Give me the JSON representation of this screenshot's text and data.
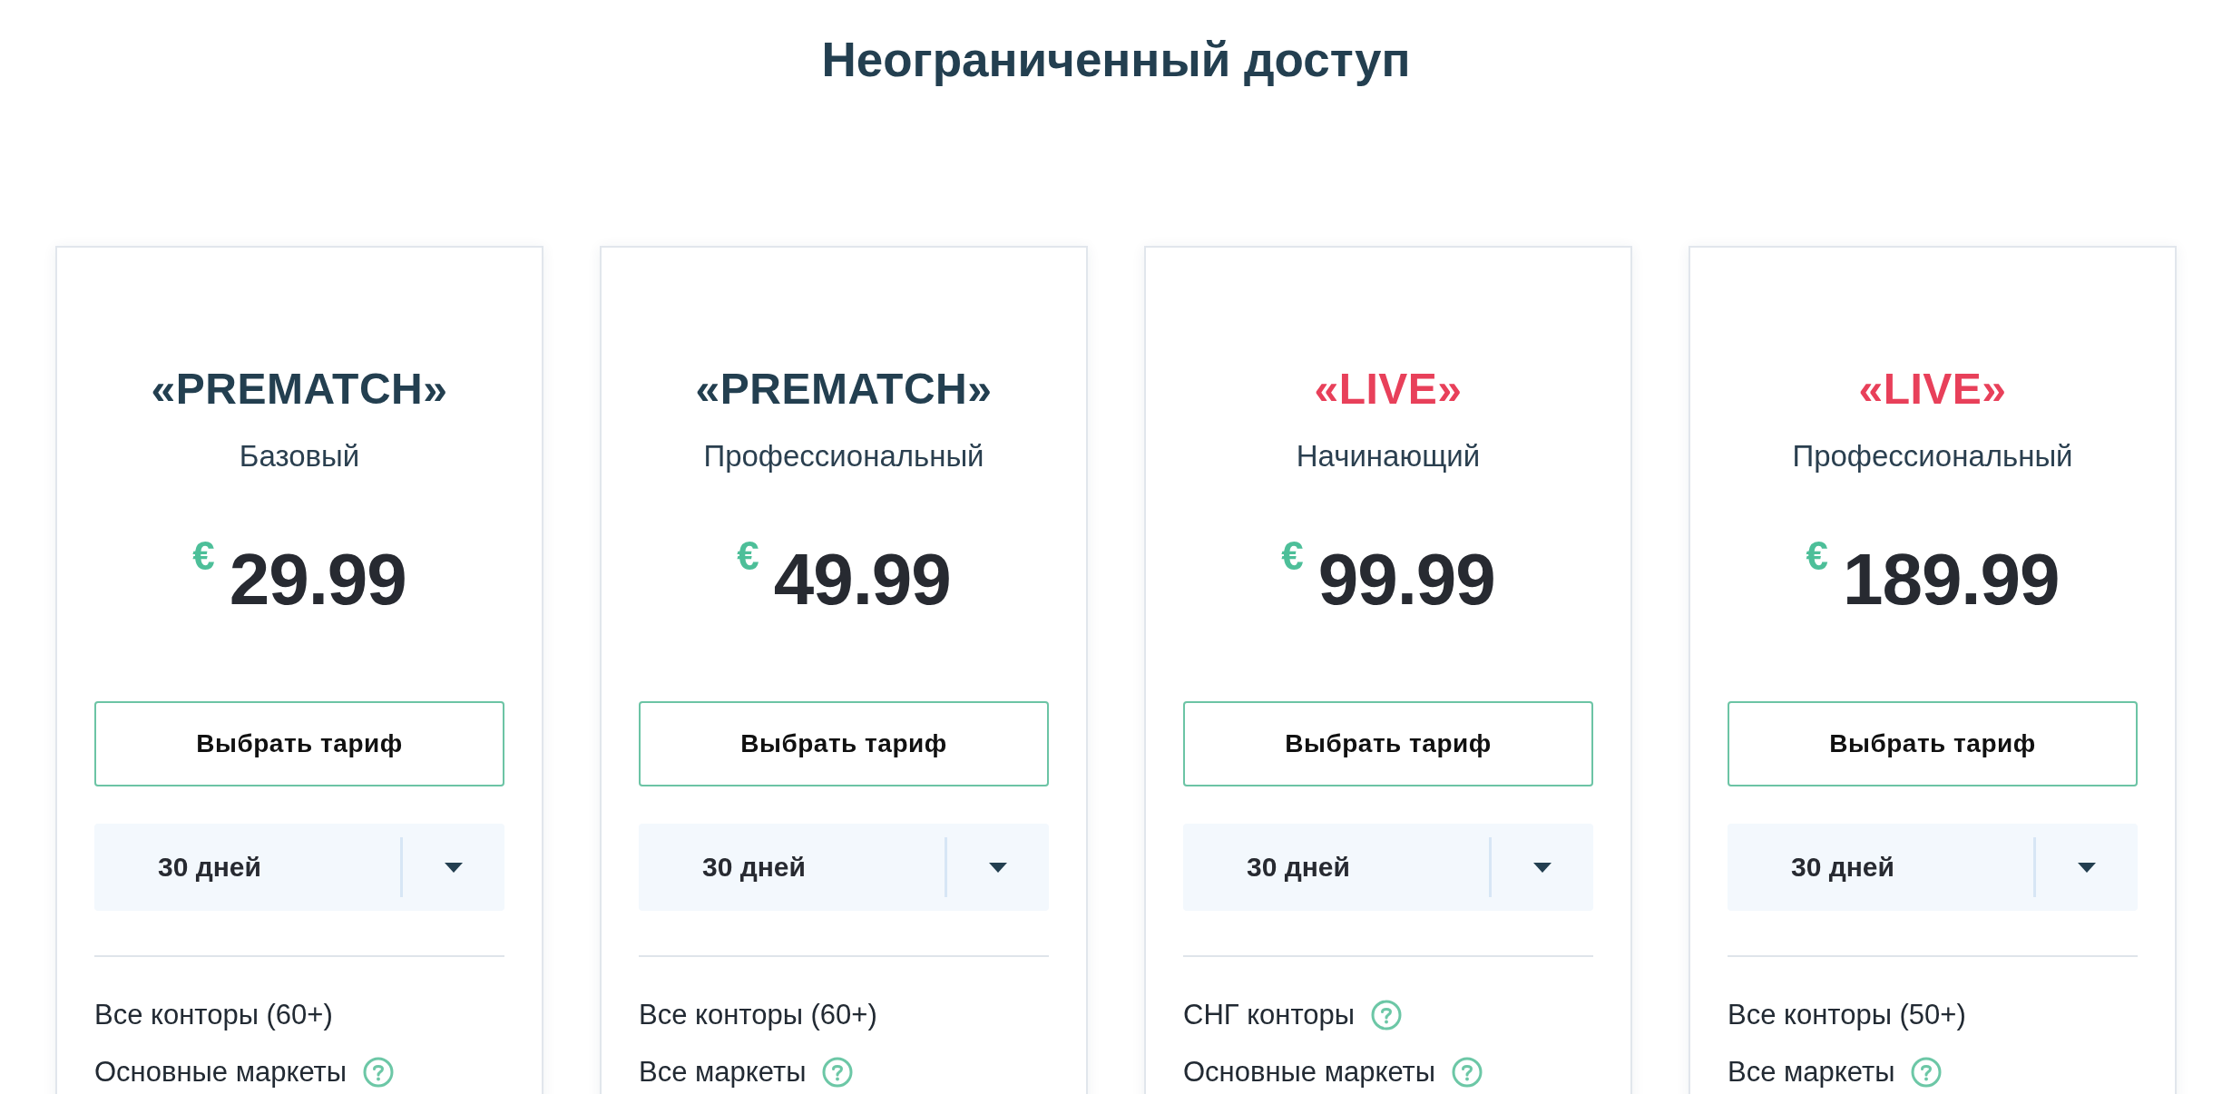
{
  "title": "Неограниченный доступ",
  "plans": [
    {
      "name": "«PREMATCH»",
      "color": "#233f50",
      "tier": "Базовый",
      "currency": "€",
      "price": "29.99",
      "button": "Выбрать тариф",
      "period": "30 дней",
      "features": [
        {
          "text": "Все конторы (60+)",
          "help": false
        },
        {
          "text": "Основные маркеты",
          "help": true
        }
      ]
    },
    {
      "name": "«PREMATCH»",
      "color": "#233f50",
      "tier": "Профессиональный",
      "currency": "€",
      "price": "49.99",
      "button": "Выбрать тариф",
      "period": "30 дней",
      "features": [
        {
          "text": "Все конторы (60+)",
          "help": false
        },
        {
          "text": "Все маркеты",
          "help": true
        }
      ]
    },
    {
      "name": "«LIVE»",
      "color": "#e8405a",
      "tier": "Начинающий",
      "currency": "€",
      "price": "99.99",
      "button": "Выбрать тариф",
      "period": "30 дней",
      "features": [
        {
          "text": "СНГ конторы",
          "help": true
        },
        {
          "text": "Основные маркеты",
          "help": true
        }
      ]
    },
    {
      "name": "«LIVE»",
      "color": "#e8405a",
      "tier": "Профессиональный",
      "currency": "€",
      "price": "189.99",
      "button": "Выбрать тариф",
      "period": "30 дней",
      "features": [
        {
          "text": "Все конторы (50+)",
          "help": false
        },
        {
          "text": "Все маркеты",
          "help": true
        }
      ]
    }
  ]
}
